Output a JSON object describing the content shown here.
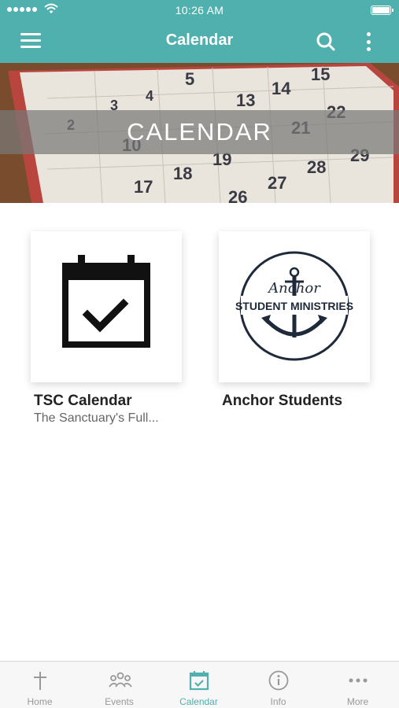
{
  "status_bar": {
    "time": "10:26 AM"
  },
  "header": {
    "title": "Calendar"
  },
  "hero": {
    "title": "CALENDAR"
  },
  "cards": [
    {
      "title": "TSC Calendar",
      "subtitle": "The Sanctuary's Full..."
    },
    {
      "title": "Anchor Students",
      "logo_script": "Anchor",
      "logo_text": "STUDENT MINISTRIES"
    }
  ],
  "tabs": [
    {
      "label": "Home",
      "icon": "cross-icon"
    },
    {
      "label": "Events",
      "icon": "people-icon"
    },
    {
      "label": "Calendar",
      "icon": "calendar-check-icon",
      "active": true
    },
    {
      "label": "Info",
      "icon": "info-icon"
    },
    {
      "label": "More",
      "icon": "dots-icon"
    }
  ],
  "colors": {
    "accent": "#4fb0ae",
    "inactive": "#999999"
  }
}
